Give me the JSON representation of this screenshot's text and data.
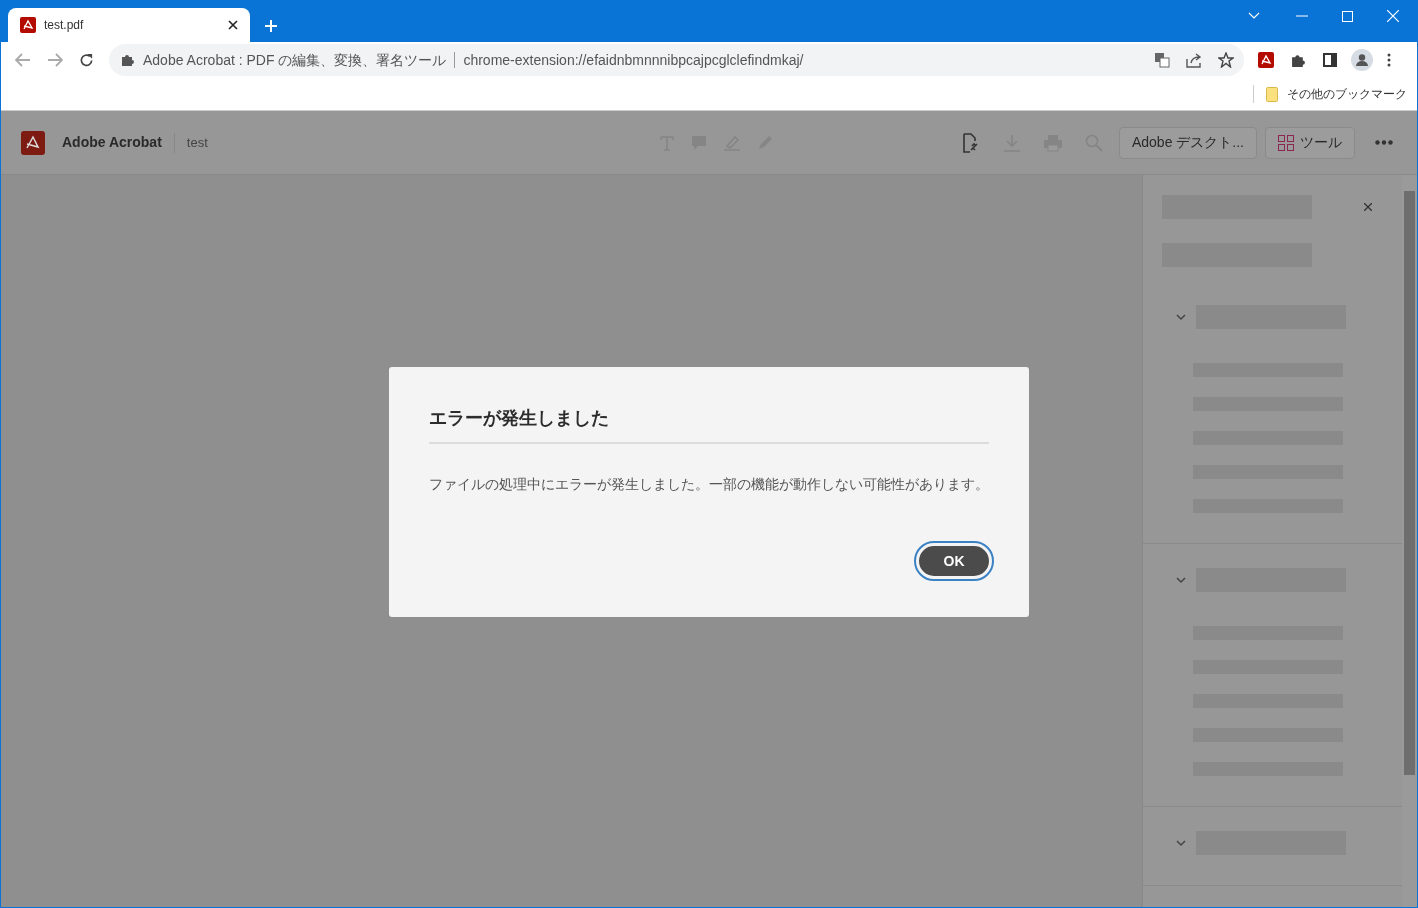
{
  "browser": {
    "tab": {
      "title": "test.pdf",
      "selected": true
    },
    "address_bar": {
      "site": "Adobe Acrobat : PDF の編集、変換、署名ツール",
      "url": "chrome-extension://efaidnbmnnnibpcajpcglclefindmkaj/"
    },
    "bookmarks": [
      "その他のブックマーク"
    ]
  },
  "app": {
    "name": "Adobe Acrobat",
    "document": "test",
    "buttons": [
      {
        "kind": "desktop",
        "label": "Adobe デスクト..."
      },
      {
        "kind": "tools",
        "label": "ツール"
      }
    ]
  },
  "side_panel": {
    "sections": [
      {
        "expanded": true
      },
      {
        "expanded": true
      },
      {
        "expanded": true
      }
    ]
  },
  "dialog": {
    "title": "エラーが発生しました",
    "message": "ファイルの処理中にエラーが発生しました。一部の機能が動作しない可能性があります。",
    "button": "OK"
  }
}
